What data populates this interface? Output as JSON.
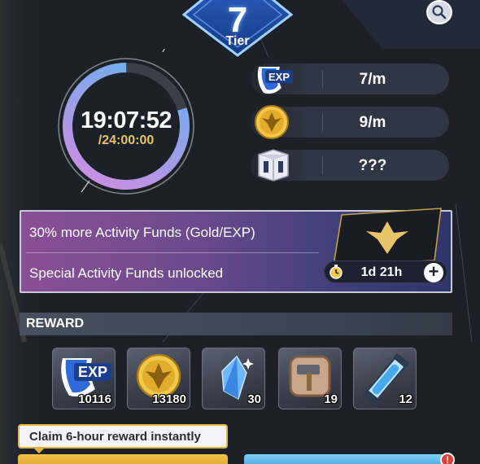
{
  "tier": {
    "number": "7",
    "label": "Tier"
  },
  "timer": {
    "elapsed": "19:07:52",
    "total": "/24:00:00",
    "progress": 0.797
  },
  "rates": [
    {
      "icon": "exp-icon",
      "icon_text": "EXP",
      "value": "7/m"
    },
    {
      "icon": "gold-coin-icon",
      "value": "9/m"
    },
    {
      "icon": "mystery-box-icon",
      "value": "???"
    }
  ],
  "funds": {
    "line1": "30% more Activity Funds (Gold/EXP)",
    "line2": "Special Activity Funds unlocked",
    "duration": "1d 21h",
    "plus": "+"
  },
  "reward": {
    "title": "REWARD",
    "items": [
      {
        "icon": "exp-icon",
        "icon_text": "EXP",
        "count": "10116"
      },
      {
        "icon": "gold-coin-icon",
        "count": "13180"
      },
      {
        "icon": "blue-crystal-icon",
        "count": "30"
      },
      {
        "icon": "hammer-icon",
        "count": "19"
      },
      {
        "icon": "test-tube-icon",
        "count": "12"
      }
    ]
  },
  "claim_tip": "Claim 6-hour reward instantly",
  "alert_badge": "!",
  "colors": {
    "accent_gold": "#e8c56a",
    "ring_blue": "#5fb4f0",
    "ring_pink": "#d58be0",
    "banner_purple": "#8a4f95"
  }
}
